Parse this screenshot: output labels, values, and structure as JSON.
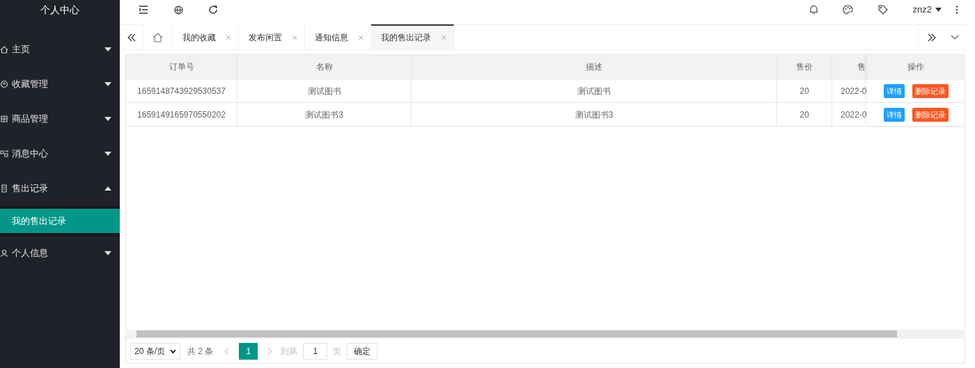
{
  "sidebar": {
    "title": "个人中心",
    "items": [
      {
        "label": "主页",
        "expanded": false
      },
      {
        "label": "收藏管理",
        "expanded": false
      },
      {
        "label": "商品管理",
        "expanded": false
      },
      {
        "label": "消息中心",
        "expanded": false
      },
      {
        "label": "售出记录",
        "expanded": true,
        "children": [
          {
            "label": "我的售出记录",
            "selected": true
          }
        ]
      },
      {
        "label": "个人信息",
        "expanded": false
      }
    ]
  },
  "header": {
    "user": "znz2"
  },
  "tabs": [
    {
      "kind": "home",
      "selected": false
    },
    {
      "kind": "page",
      "label": "我的收藏",
      "selected": false
    },
    {
      "kind": "page",
      "label": "发布闲置",
      "selected": false
    },
    {
      "kind": "page",
      "label": "通知信息",
      "selected": false
    },
    {
      "kind": "page",
      "label": "我的售出记录",
      "selected": true
    }
  ],
  "table": {
    "columns": [
      "订单号",
      "名称",
      "描述",
      "售价",
      "售"
    ],
    "action_column": "操作",
    "rows": [
      {
        "cells": [
          "1659148743929530537",
          "测试图书",
          "测试图书",
          "20",
          "2022-0"
        ],
        "actions": [
          "详情",
          "删除记录"
        ]
      },
      {
        "cells": [
          "1659149165970550202",
          "测试图书3",
          "测试图书3",
          "20",
          "2022-0"
        ],
        "actions": [
          "详情",
          "删除记录"
        ]
      }
    ]
  },
  "pagination": {
    "page_size": "20 条/页",
    "total": "共 2 条",
    "pages": [
      {
        "label": "1",
        "selected": true
      }
    ],
    "goto_label": "到第",
    "goto_value": "1",
    "page_suffix": "页",
    "confirm": "确定"
  }
}
